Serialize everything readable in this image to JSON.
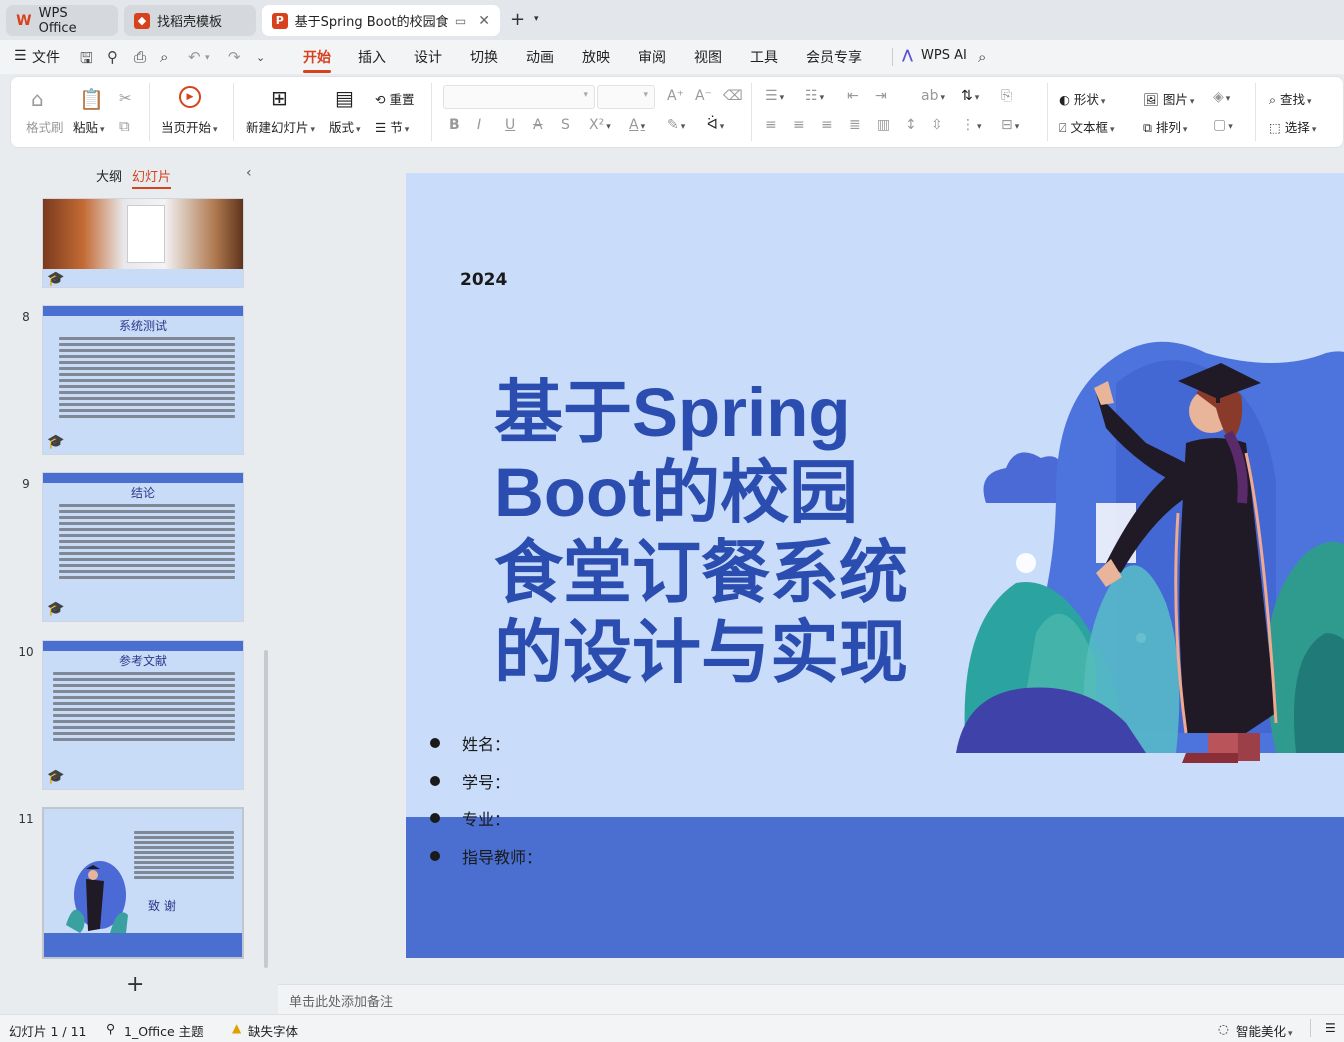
{
  "tabs": [
    {
      "label": "WPS Office"
    },
    {
      "label": "找稻壳模板"
    },
    {
      "label": "基于Spring Boot的校园食堂i"
    }
  ],
  "menu": {
    "file": "文件",
    "items": [
      "开始",
      "插入",
      "设计",
      "切换",
      "动画",
      "放映",
      "审阅",
      "视图",
      "工具",
      "会员专享"
    ],
    "active": "开始",
    "wps_ai": "WPS AI"
  },
  "ribbon": {
    "format_painter": "格式刷",
    "paste": "粘贴",
    "play_current": "当页开始",
    "new_slide": "新建幻灯片",
    "layout": "版式",
    "reset": "重置",
    "section": "节",
    "shape": "形状",
    "picture": "图片",
    "textbox": "文本框",
    "arrange": "排列",
    "find": "查找",
    "select": "选择"
  },
  "left_panel": {
    "tab_outline": "大纲",
    "tab_slides": "幻灯片",
    "slides": [
      {
        "num": "8",
        "title": "系统测试"
      },
      {
        "num": "9",
        "title": "结论"
      },
      {
        "num": "10",
        "title": "参考文献"
      },
      {
        "num": "11",
        "title": "致 谢"
      }
    ]
  },
  "slide": {
    "year": "2024",
    "title_lines": [
      "基于Spring",
      "Boot的校园",
      "食堂订餐系统",
      "的设计与实现"
    ],
    "bullets": [
      "姓名：",
      "学号：",
      "专业：",
      "指导教师："
    ]
  },
  "notes_placeholder": "单击此处添加备注",
  "status": {
    "slide_count": "幻灯片 1 / 11",
    "theme": "1_Office 主题",
    "missing_font": "缺失字体",
    "smart_beautify": "智能美化"
  },
  "colors": {
    "accent": "#d7421d",
    "slide_bg": "#c9ddfb",
    "slide_band": "#4a6fd1",
    "title": "#2b4db0"
  }
}
